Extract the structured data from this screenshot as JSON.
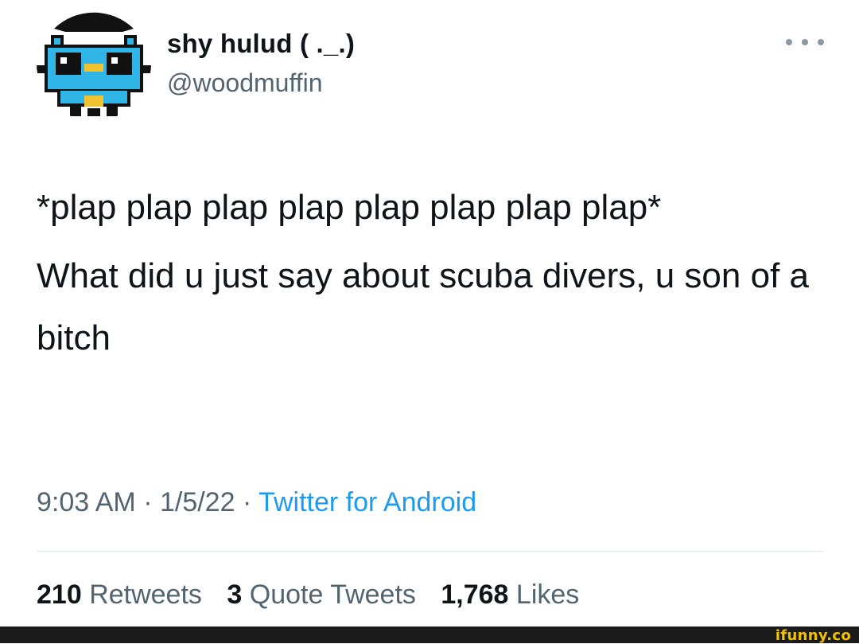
{
  "author": {
    "display_name": "shy hulud ( ._.)",
    "handle": "@woodmuffin",
    "avatar_icon": "pixel-creature-avatar"
  },
  "more_icon": "more-options-icon",
  "tweet": {
    "line1": "*plap plap plap plap plap plap plap plap*",
    "line2": "What did u just say about scuba divers, u son of a bitch"
  },
  "meta": {
    "time": "9:03 AM",
    "separator": " · ",
    "date": "1/5/22",
    "source": "Twitter for Android"
  },
  "stats": {
    "retweets_count": "210",
    "retweets_label": "Retweets",
    "quotes_count": "3",
    "quotes_label": "Quote Tweets",
    "likes_count": "1,768",
    "likes_label": "Likes"
  },
  "watermark": "ifunny.co",
  "colors": {
    "text": "#0f1419",
    "secondary": "#536471",
    "link": "#1d9bf0",
    "avatar_blue": "#2fb5e6",
    "avatar_yellow": "#f1c232",
    "watermark": "#f2c200"
  }
}
